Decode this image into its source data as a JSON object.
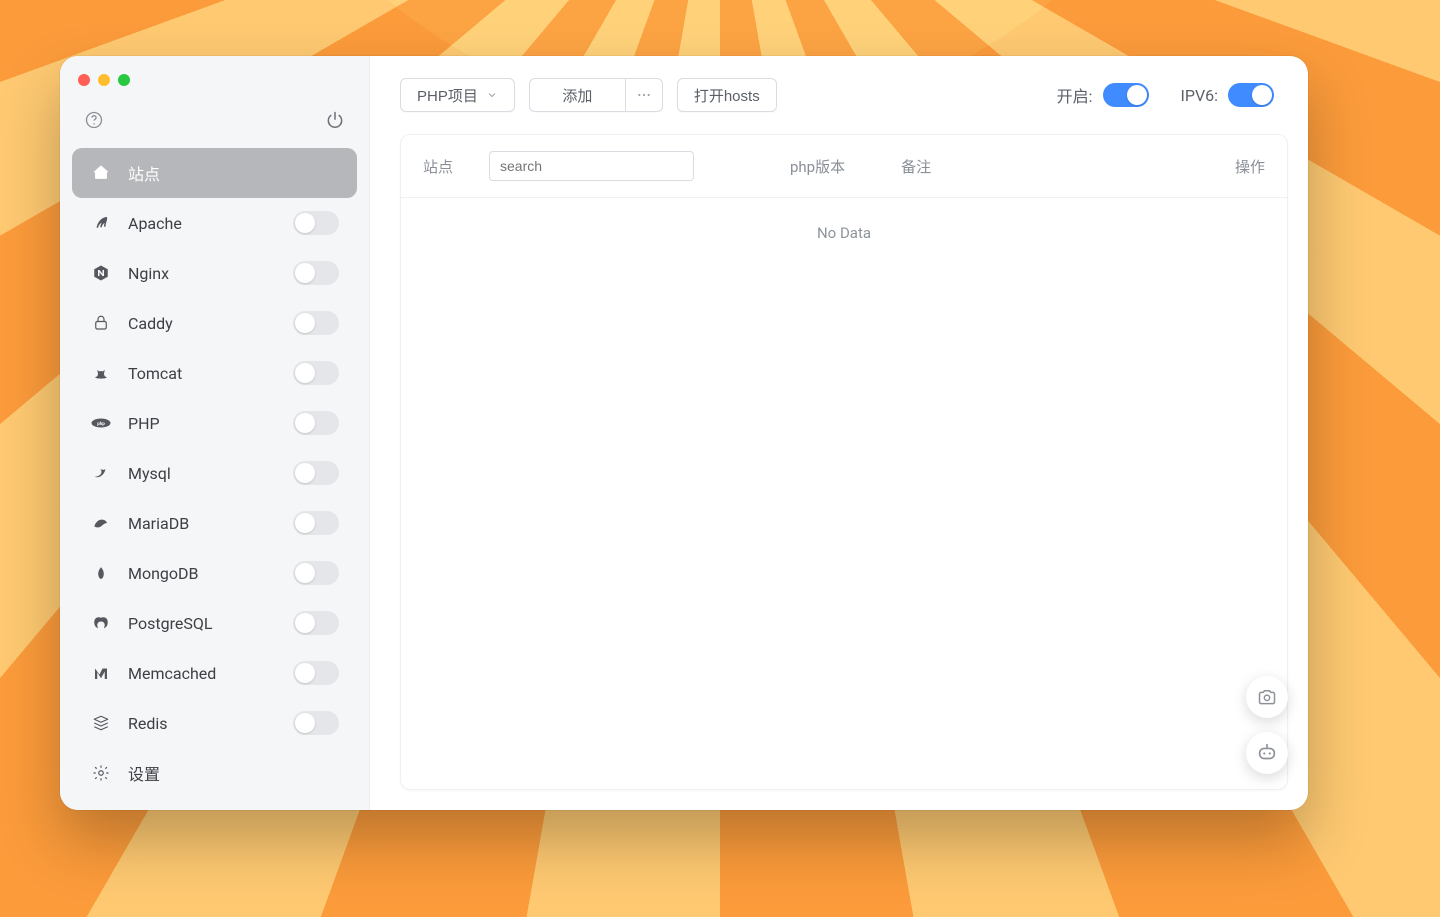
{
  "sidebar": {
    "items": [
      {
        "id": "sites",
        "label": "站点",
        "icon": "home",
        "toggle": null,
        "active": true
      },
      {
        "id": "apache",
        "label": "Apache",
        "icon": "feather",
        "toggle": false
      },
      {
        "id": "nginx",
        "label": "Nginx",
        "icon": "nginx",
        "toggle": false
      },
      {
        "id": "caddy",
        "label": "Caddy",
        "icon": "lock",
        "toggle": false
      },
      {
        "id": "tomcat",
        "label": "Tomcat",
        "icon": "cat",
        "toggle": false
      },
      {
        "id": "php",
        "label": "PHP",
        "icon": "php",
        "toggle": false
      },
      {
        "id": "mysql",
        "label": "Mysql",
        "icon": "dolphin",
        "toggle": false
      },
      {
        "id": "mariadb",
        "label": "MariaDB",
        "icon": "seal",
        "toggle": false
      },
      {
        "id": "mongodb",
        "label": "MongoDB",
        "icon": "leaf",
        "toggle": false
      },
      {
        "id": "postgresql",
        "label": "PostgreSQL",
        "icon": "elephant",
        "toggle": false
      },
      {
        "id": "memcached",
        "label": "Memcached",
        "icon": "m",
        "toggle": false
      },
      {
        "id": "redis",
        "label": "Redis",
        "icon": "stack",
        "toggle": false
      },
      {
        "id": "settings",
        "label": "设置",
        "icon": "gear",
        "toggle": null
      }
    ]
  },
  "toolbar": {
    "project_type_label": "PHP项目",
    "add_label": "添加",
    "open_hosts_label": "打开hosts",
    "enable_label": "开启:",
    "enable_value": true,
    "ipv6_label": "IPV6:",
    "ipv6_value": true
  },
  "table": {
    "columns": {
      "site": "站点",
      "php_version": "php版本",
      "notes": "备注",
      "action": "操作"
    },
    "search_placeholder": "search",
    "empty_text": "No Data",
    "rows": []
  },
  "colors": {
    "accent": "#3f8bff"
  }
}
